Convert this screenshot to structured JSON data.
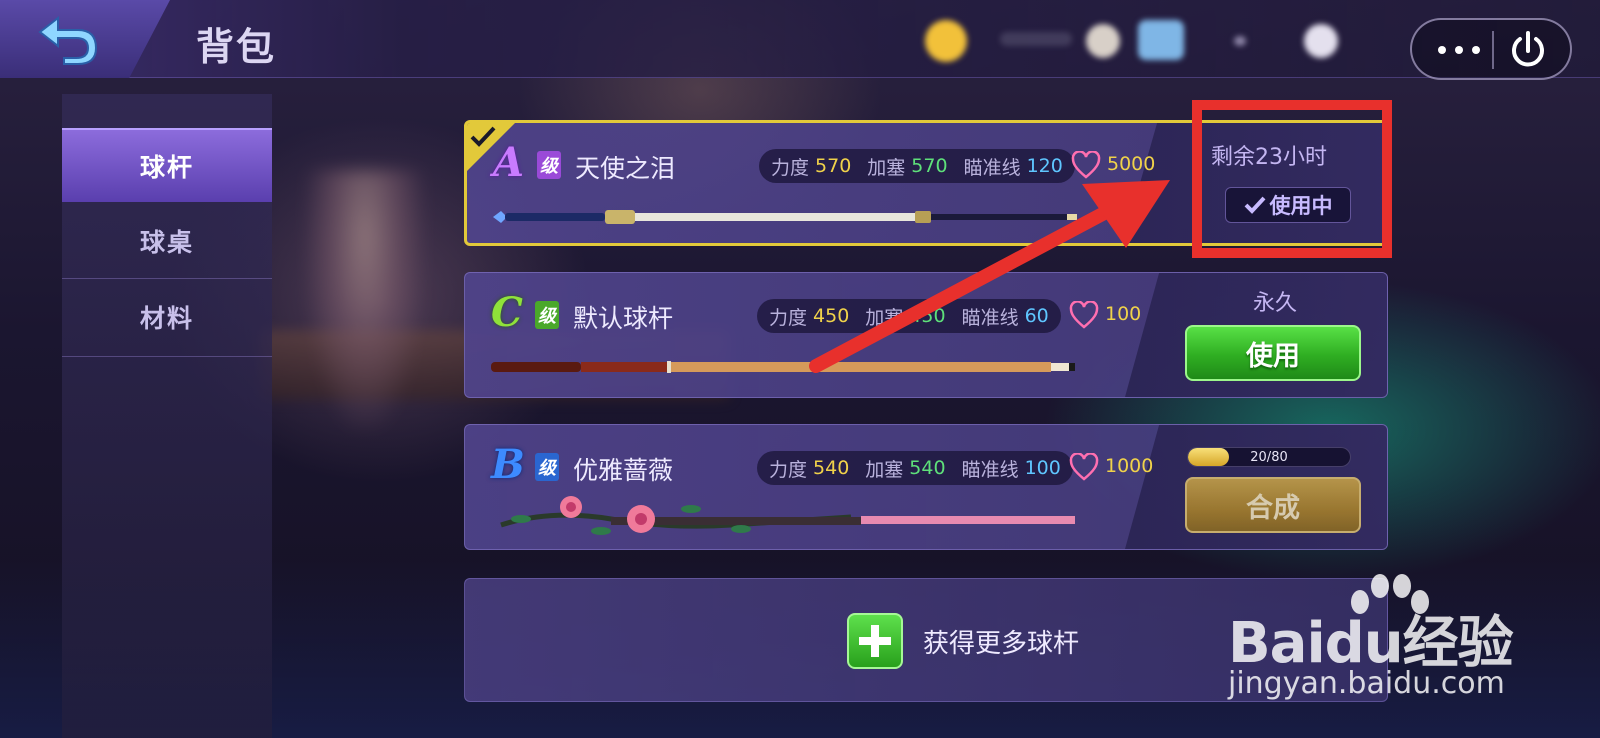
{
  "header": {
    "title": "背包",
    "back_icon": "back-arrow-icon",
    "more_icon": "more-dots-icon",
    "power_icon": "power-icon"
  },
  "sidebar": {
    "items": [
      {
        "label": "球杆",
        "active": true
      },
      {
        "label": "球桌",
        "active": false
      },
      {
        "label": "材料",
        "active": false
      }
    ]
  },
  "stat_labels": {
    "power": "力度",
    "spin": "加塞",
    "aim": "瞄准线"
  },
  "cues": [
    {
      "grade": "A",
      "grade_suffix": "级",
      "name": "天使之泪",
      "power": "570",
      "spin": "570",
      "aim": "120",
      "likes": "5000",
      "status": "剩余23小时",
      "action": "使用中",
      "selected": true
    },
    {
      "grade": "C",
      "grade_suffix": "级",
      "name": "默认球杆",
      "power": "450",
      "spin": "450",
      "aim": "60",
      "likes": "100",
      "status": "永久",
      "action": "使用",
      "selected": false
    },
    {
      "grade": "B",
      "grade_suffix": "级",
      "name": "优雅蔷薇",
      "power": "540",
      "spin": "540",
      "aim": "100",
      "likes": "1000",
      "progress_text": "20/80",
      "progress": 0.25,
      "action": "合成",
      "selected": false
    }
  ],
  "more": {
    "label": "获得更多球杆"
  },
  "watermark": {
    "logo": "Baidu经验",
    "url": "jingyan.baidu.com"
  },
  "colors": {
    "grade_a": "#c97bff",
    "grade_b": "#3d8bff",
    "grade_c": "#8fe23a",
    "selected_border": "#e2c93a",
    "annotation_red": "#e8302c",
    "use_green": "#2fae22",
    "synth_gold": "#a57f2c"
  }
}
